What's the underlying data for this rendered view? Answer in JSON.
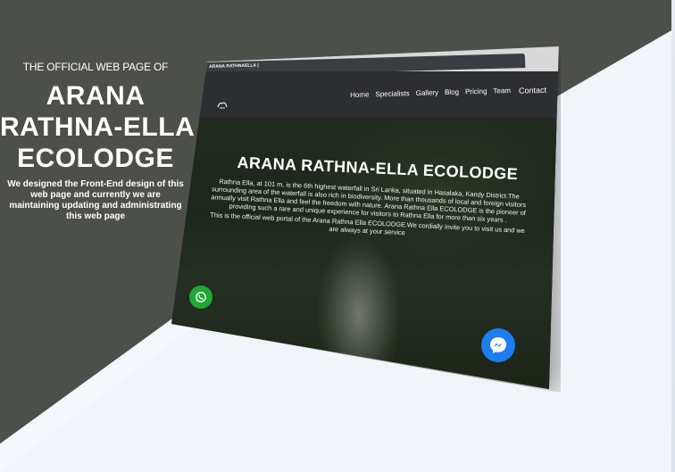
{
  "left_panel": {
    "eyebrow": "THE OFFICIAL WEB PAGE OF",
    "title_lines": [
      "ARANA",
      "RATHNA-ELLA",
      "ECOLODGE"
    ],
    "description": "We designed the Front-End design of this web page and currently we are maintaining updating and administrating this web page"
  },
  "mockup": {
    "tab_title": "ARANA RATHNAELLA |",
    "logo_icon": "waterfall-logo-icon",
    "nav": [
      "Home",
      "Specialists",
      "Gallery",
      "Blog",
      "Pricing",
      "Team",
      "Contact"
    ],
    "hero_title": "ARANA RATHNA-ELLA ECOLODGE",
    "hero_paragraphs": [
      "Rathna Ella, at 101 m, is the 6th highest waterfall in Sri Lanka, situated in Hasalaka, Kandy District.The surrounding area of the waterfall is also rich in biodiversity. More than thousands of local and foreign visitors annually visit Rathna Ella and feel the freedom with nature. Arana Rathna Ella ECOLODGE is the pioneer of providing such a rare and unique experience for visitors to Rathna Ella for more than six years .",
      "This is the official web portal of the Arana Rathna Ella ECOLODGE.We cordially invite you to visit us and we are always at your service"
    ]
  },
  "colors": {
    "dark_panel": "#4d4f4a",
    "whatsapp": "#1fa834",
    "messenger": "#1e7df0"
  }
}
